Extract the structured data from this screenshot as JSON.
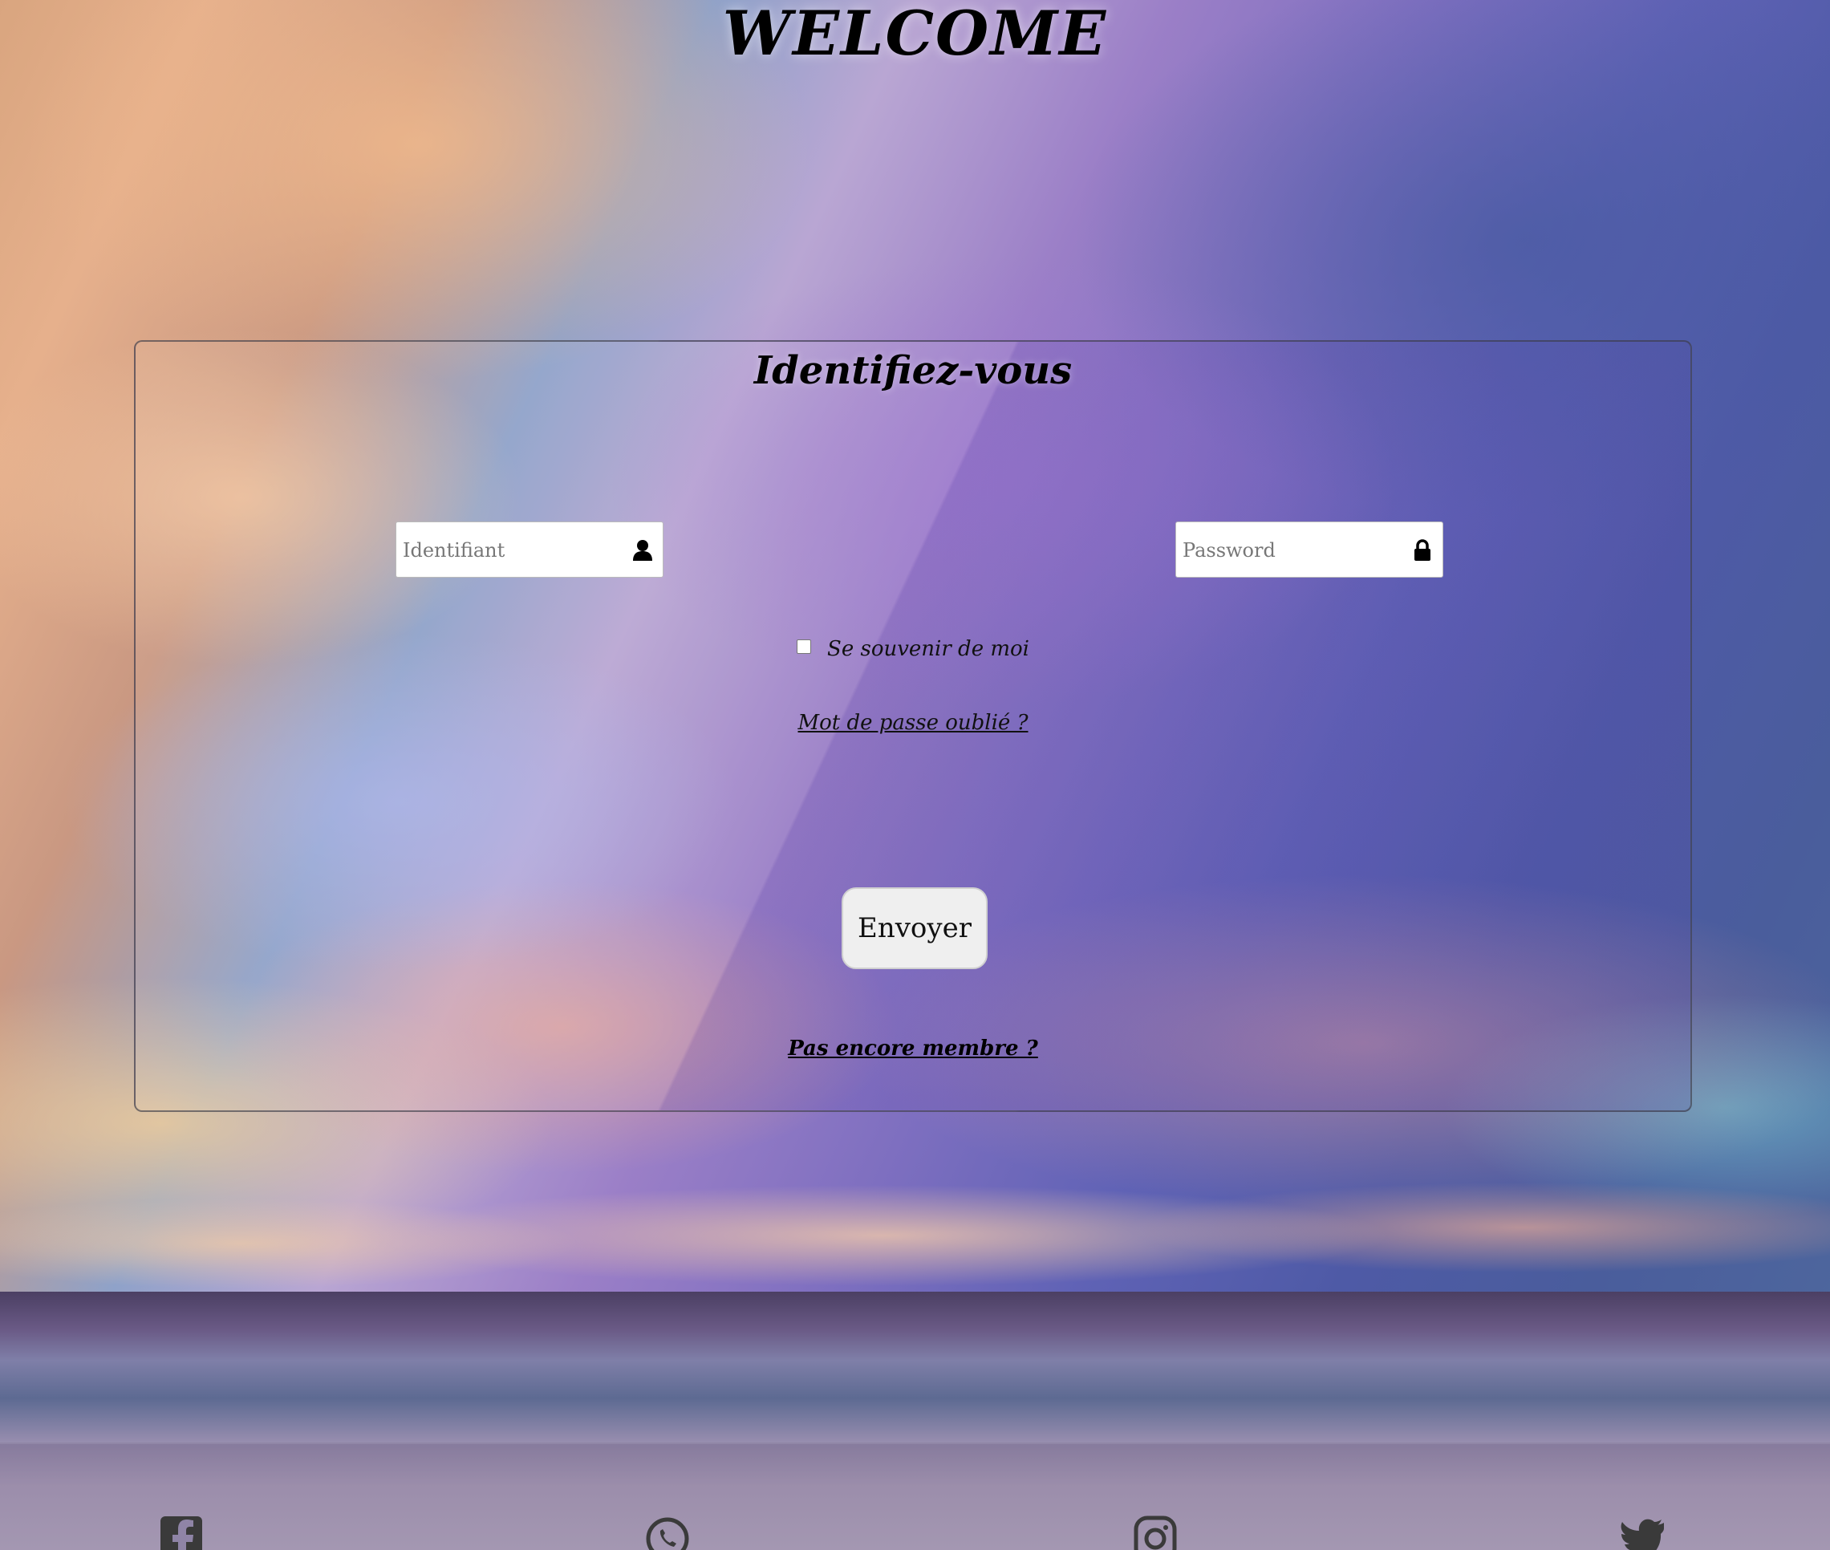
{
  "page": {
    "heading": "WELCOME"
  },
  "login_panel": {
    "title": "Identifiez-vous",
    "username_placeholder": "Identifiant",
    "password_placeholder": "Password",
    "remember_label": "Se souvenir de moi",
    "forgot_link": "Mot de passe oublié ?",
    "submit_label": "Envoyer",
    "register_link": "Pas encore membre ?"
  },
  "footer": {
    "social_icons": [
      "facebook-icon",
      "whatsapp-icon",
      "instagram-icon",
      "twitter-icon"
    ],
    "icon_color": "#3a3a3a"
  }
}
